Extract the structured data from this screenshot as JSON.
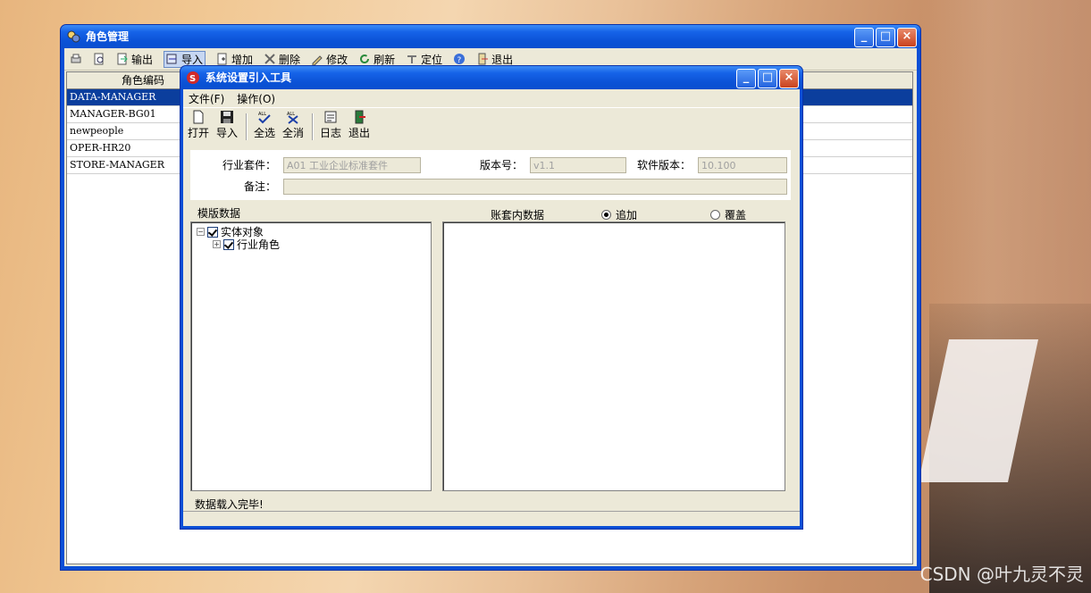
{
  "background": {
    "watermark": "CSDN @叶九灵不灵"
  },
  "back_window": {
    "title": "角色管理",
    "toolbar": [
      {
        "label": "",
        "icon": "print-icon"
      },
      {
        "label": "",
        "icon": "preview-icon"
      },
      {
        "label": "输出",
        "icon": "export-icon"
      },
      {
        "label": "导入",
        "icon": "import-icon"
      },
      {
        "label": "增加",
        "icon": "add-icon"
      },
      {
        "label": "删除",
        "icon": "delete-icon"
      },
      {
        "label": "修改",
        "icon": "edit-icon"
      },
      {
        "label": "刷新",
        "icon": "refresh-icon"
      },
      {
        "label": "定位",
        "icon": "locate-icon"
      },
      {
        "label": "",
        "icon": "help-icon"
      },
      {
        "label": "退出",
        "icon": "exit-icon"
      }
    ],
    "column_header": "角色编码",
    "rows": [
      "DATA-MANAGER",
      "MANAGER-BG01",
      "newpeople",
      "OPER-HR20",
      "STORE-MANAGER"
    ]
  },
  "dialog": {
    "title": "系统设置引入工具",
    "menu": [
      "文件(F)",
      "操作(O)"
    ],
    "tools": [
      "打开",
      "导入",
      "全选",
      "全消",
      "日志",
      "退出"
    ],
    "industry_label": "行业套件：",
    "industry_value": "A01 工业企业标准套件",
    "version_label": "版本号：",
    "version_value": "v1.1",
    "software_label": "软件版本：",
    "software_value": "10.100",
    "remark_label": "备注：",
    "remark_value": "",
    "template_label": "模版数据",
    "account_label": "账套内数据",
    "radio_append": "追加",
    "radio_overwrite": "覆盖",
    "tree": {
      "root": "实体对象",
      "child": "行业角色"
    },
    "status": "数据载入完毕!"
  },
  "colors": {
    "title_blue": "#0a4fd6",
    "selection": "#0b3e9d",
    "face": "#ece9d8"
  }
}
